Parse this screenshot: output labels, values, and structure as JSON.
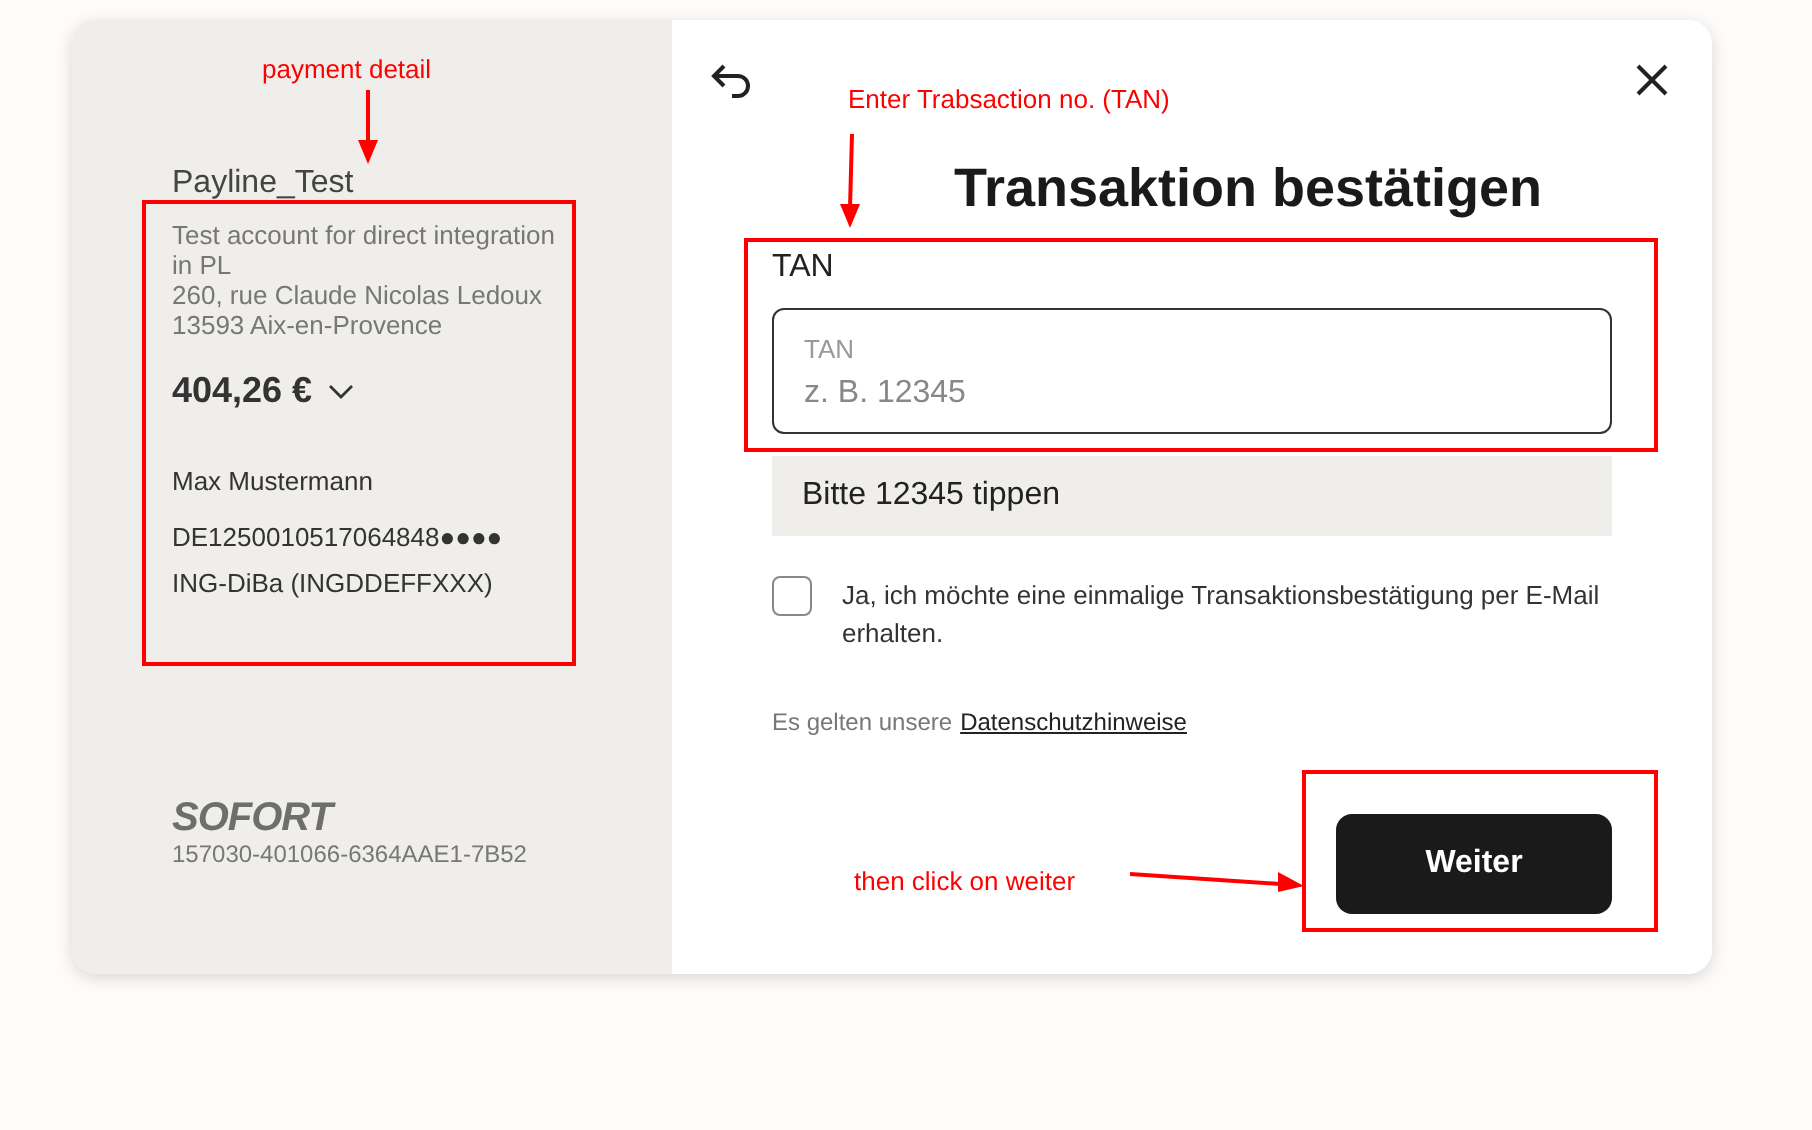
{
  "merchant": {
    "name": "Payline_Test",
    "description": [
      "Test account for direct integration in PL",
      "260, rue Claude Nicolas Ledoux",
      "13593 Aix-en-Provence"
    ],
    "amount": "404,26 €",
    "payer": "Max Mustermann",
    "iban": "DE1250010517064848●●●●",
    "bank": "ING-DiBa (INGDDEFFXXX)"
  },
  "brand": {
    "logo": "SOFORT",
    "reference": "157030-401066-6364AAE1-7B52"
  },
  "title": "Transaktion bestätigen",
  "tan": {
    "label": "TAN",
    "floating_label": "TAN",
    "placeholder": "z. B. 12345"
  },
  "hint": "Bitte 12345 tippen",
  "email_confirmation": {
    "label": "Ja, ich möchte eine einmalige Transaktionsbestätigung per E-Mail erhalten.",
    "checked": false
  },
  "privacy": {
    "text": "Es gelten unsere",
    "link": "Datenschutzhinweise"
  },
  "button": "Weiter",
  "annotations": [
    {
      "text": "payment detail"
    },
    {
      "text": "Enter Trabsaction no. (TAN)"
    },
    {
      "text": "then click on weiter"
    }
  ]
}
